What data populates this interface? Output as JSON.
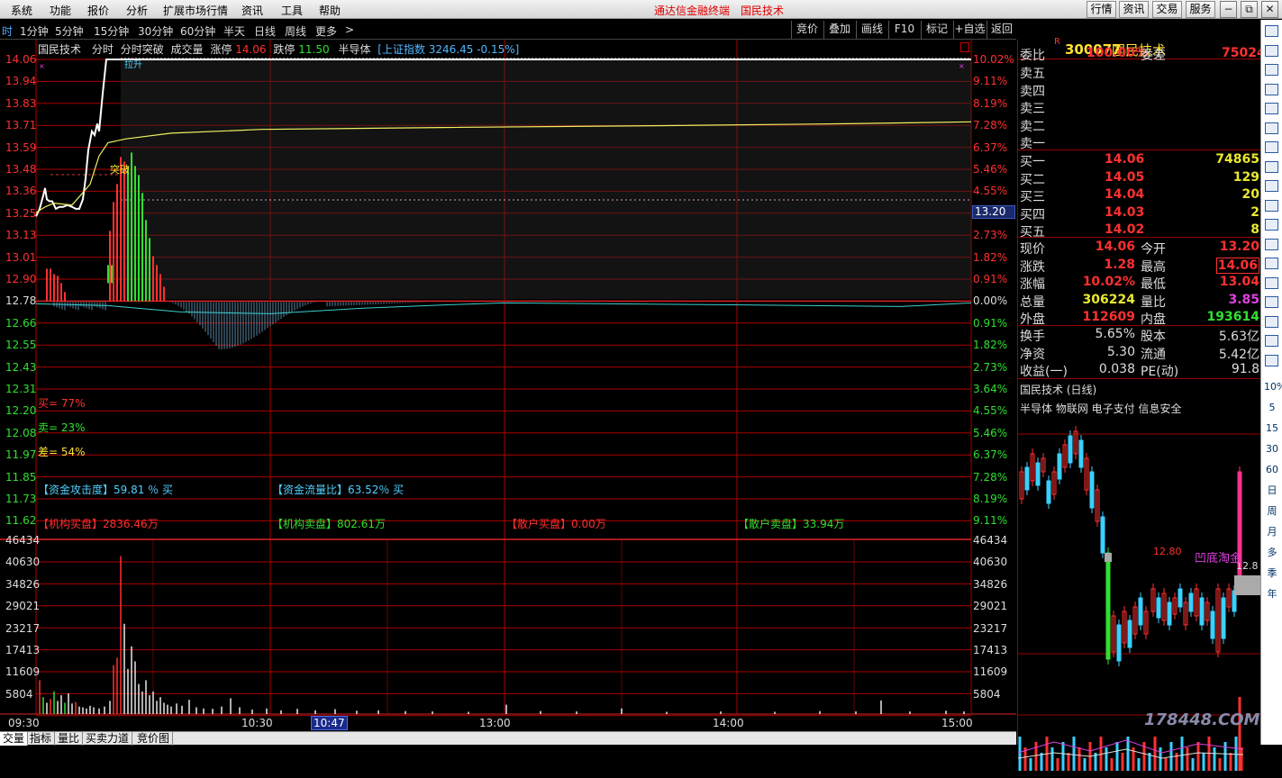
{
  "menu": [
    "系统",
    "功能",
    "报价",
    "分析",
    "扩展市场行情",
    "资讯",
    "工具",
    "帮助"
  ],
  "app_title": "通达信金融终端",
  "stock_title": "国民技术",
  "top_buttons": [
    "行情",
    "资讯",
    "交易",
    "服务"
  ],
  "window_buttons": [
    "−",
    "⧉",
    "✕"
  ],
  "periods": [
    "时",
    "1分钟",
    "5分钟",
    "15分钟",
    "30分钟",
    "60分钟",
    "半天",
    "日线",
    "周线",
    "更多",
    ">"
  ],
  "tools": [
    "竞价",
    "叠加",
    "画线",
    "F10",
    "标记",
    "+自选",
    "返回"
  ],
  "info": {
    "name": "国民技术",
    "items": [
      "分时",
      "分时突破",
      "成交量"
    ],
    "limit_up_label": "涨停",
    "limit_up": "14.06",
    "limit_down_label": "跌停",
    "limit_down": "11.50",
    "sector": "半导体",
    "index_text": "[上证指数 3246.45 -0.15%]"
  },
  "price_labels": [
    "14.06",
    "13.94",
    "13.83",
    "13.71",
    "13.59",
    "13.48",
    "13.36",
    "13.25",
    "13.13",
    "13.01",
    "12.90",
    "12.78",
    "12.66",
    "12.55",
    "12.43",
    "12.31",
    "12.20",
    "12.08",
    "11.97",
    "11.85",
    "11.73",
    "11.62"
  ],
  "pct_labels": [
    "10.02%",
    "9.11%",
    "8.19%",
    "7.28%",
    "6.37%",
    "5.46%",
    "4.55%",
    "3.64%",
    "2.73%",
    "1.82%",
    "0.91%",
    "0.00%",
    "0.91%",
    "1.82%",
    "2.73%",
    "3.64%",
    "4.55%",
    "5.46%",
    "6.37%",
    "7.28%",
    "8.19%",
    "9.11%"
  ],
  "cursor_price": "13.20",
  "volume_labels": [
    "46434",
    "40630",
    "34826",
    "29021",
    "23217",
    "17413",
    "11609",
    "5804"
  ],
  "time_labels": [
    "09:30",
    "10:30",
    "13:00",
    "14:00",
    "15:00"
  ],
  "cursor_time": "10:47",
  "annotations": {
    "la_sheng": "拉升",
    "tu_po": "突破",
    "buy_ratio": "买= 77%",
    "sell_ratio": "卖= 23%",
    "diff_ratio": "差= 54%",
    "capital_attack": "【资金攻击度】59.81 ％ 买",
    "capital_flow": "【资金流量比】63.52％ 买",
    "inst_buy": "【机构买盘】2836.46万",
    "inst_sell": "【机构卖盘】802.61万",
    "retail_buy": "【散户买盘】0.00万",
    "retail_sell": "【散户卖盘】33.94万"
  },
  "quote": {
    "code": "300077",
    "name": "国民技术",
    "r_mark": "R",
    "weibi_label": "委比",
    "weibi": "100.00%",
    "weicha_label": "委差",
    "weicha": "75024",
    "asks": [
      "卖五",
      "卖四",
      "卖三",
      "卖二",
      "卖一"
    ],
    "bids": [
      {
        "label": "买一",
        "price": "14.06",
        "vol": "74865"
      },
      {
        "label": "买二",
        "price": "14.05",
        "vol": "129"
      },
      {
        "label": "买三",
        "price": "14.04",
        "vol": "20"
      },
      {
        "label": "买四",
        "price": "14.03",
        "vol": "2"
      },
      {
        "label": "买五",
        "price": "14.02",
        "vol": "8"
      }
    ],
    "stats": [
      {
        "l1": "现价",
        "v1": "14.06",
        "l2": "今开",
        "v2": "13.20",
        "c1": "#ff3030",
        "c2": "#ff3030"
      },
      {
        "l1": "涨跌",
        "v1": "1.28",
        "l2": "最高",
        "v2": "14.06",
        "c1": "#ff3030",
        "c2": "#ff3030"
      },
      {
        "l1": "涨幅",
        "v1": "10.02%",
        "l2": "最低",
        "v2": "13.04",
        "c1": "#ff3030",
        "c2": "#ff3030"
      },
      {
        "l1": "总量",
        "v1": "306224",
        "l2": "量比",
        "v2": "3.85",
        "c1": "#e8e830",
        "c2": "#e040e0"
      },
      {
        "l1": "外盘",
        "v1": "112609",
        "l2": "内盘",
        "v2": "193614",
        "c1": "#ff3030",
        "c2": "#30e030"
      }
    ],
    "stats2": [
      {
        "l1": "换手",
        "v1": "5.65%",
        "l2": "股本",
        "v2": "5.63亿"
      },
      {
        "l1": "净资",
        "v1": "5.30",
        "l2": "流通",
        "v2": "5.42亿"
      },
      {
        "l1": "收益(一)",
        "v1": "0.038",
        "l2": "PE(动)",
        "v2": "91.8"
      }
    ],
    "daily_title": "国民技术 (日线)",
    "concepts": "半导体 物联网 电子支付 信息安全",
    "mini_label_1": "12.80",
    "mini_label_2": "12.8",
    "mini_label_3": "凹底淘金"
  },
  "sidebar": [
    "10%",
    "5",
    "15",
    "30",
    "60",
    "日",
    "周",
    "月",
    "多",
    "季",
    "年"
  ],
  "bottom_tabs": [
    "交量",
    "指标",
    "量比",
    "买卖力道",
    "竞价图"
  ],
  "watermark": "178448.COM",
  "colors": {
    "up": "#ff3030",
    "down": "#30e030",
    "grid": "#cc0000",
    "price_line": "#ffffff",
    "avg_line": "#f0f060"
  }
}
